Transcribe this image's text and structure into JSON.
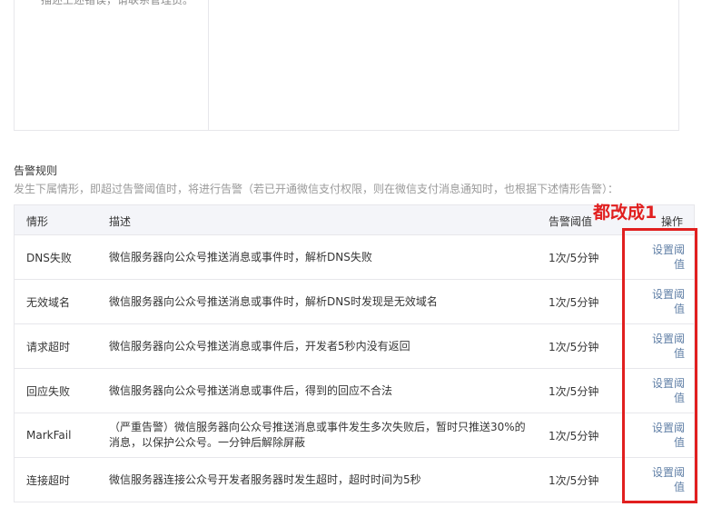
{
  "top_panel": {
    "text": "描述上述错误，请联系管理员。"
  },
  "section": {
    "title": "告警规则",
    "description": "发生下属情形，即超过告警阈值时，将进行告警（若已开通微信支付权限，则在微信支付消息通知时，也根据下述情形告警）："
  },
  "table": {
    "headers": {
      "case": "情形",
      "desc": "描述",
      "threshold": "告警阈值",
      "action": "操作"
    },
    "rows": [
      {
        "case": "DNS失败",
        "desc": "微信服务器向公众号推送消息或事件时，解析DNS失败",
        "threshold": "1次/5分钟",
        "action": "设置阈值"
      },
      {
        "case": "无效域名",
        "desc": "微信服务器向公众号推送消息或事件时，解析DNS时发现是无效域名",
        "threshold": "1次/5分钟",
        "action": "设置阈值"
      },
      {
        "case": "请求超时",
        "desc": "微信服务器向公众号推送消息或事件后，开发者5秒内没有返回",
        "threshold": "1次/5分钟",
        "action": "设置阈值"
      },
      {
        "case": "回应失败",
        "desc": "微信服务器向公众号推送消息或事件后，得到的回应不合法",
        "threshold": "1次/5分钟",
        "action": "设置阈值"
      },
      {
        "case": "MarkFail",
        "desc": "（严重告警）微信服务器向公众号推送消息或事件发生多次失败后，暂时只推送30%的消息，以保护公众号。一分钟后解除屏蔽",
        "threshold": "1次/5分钟",
        "action": "设置阈值"
      },
      {
        "case": "连接超时",
        "desc": "微信服务器连接公众号开发者服务器时发生超时，超时时间为5秒",
        "threshold": "1次/5分钟",
        "action": "设置阈值"
      }
    ]
  },
  "annotation": {
    "text": "都改成1",
    "color": "#e11f1f"
  },
  "colors": {
    "link": "#607fa6",
    "header_bg": "#f4f5f9",
    "border": "#e7e7eb",
    "desc_text": "#9a9a9a"
  }
}
